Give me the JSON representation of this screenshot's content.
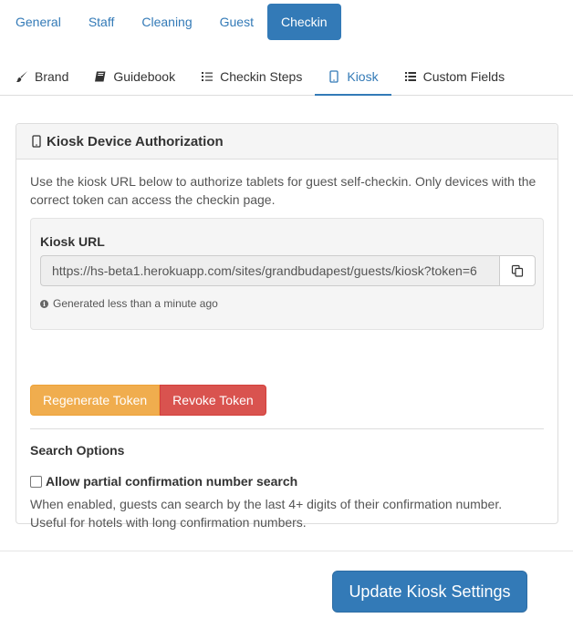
{
  "top_nav": {
    "items": [
      {
        "label": "General"
      },
      {
        "label": "Staff"
      },
      {
        "label": "Cleaning"
      },
      {
        "label": "Guest"
      },
      {
        "label": "Checkin"
      }
    ],
    "active_index": 4
  },
  "sub_tabs": {
    "items": [
      {
        "label": "Brand",
        "icon": "paintbrush-icon"
      },
      {
        "label": "Guidebook",
        "icon": "book-icon"
      },
      {
        "label": "Checkin Steps",
        "icon": "list-icon"
      },
      {
        "label": "Kiosk",
        "icon": "tablet-icon"
      },
      {
        "label": "Custom Fields",
        "icon": "list-icon"
      }
    ],
    "active_index": 3
  },
  "panel": {
    "title": "Kiosk Device Authorization",
    "title_icon": "tablet-icon",
    "description": "Use the kiosk URL below to authorize tablets for guest self-checkin. Only devices with the correct token can access the checkin page.",
    "kiosk_url": {
      "label": "Kiosk URL",
      "value": "https://hs-beta1.herokuapp.com/sites/grandbudapest/guests/kiosk?token=6",
      "copy_icon": "copy-icon",
      "help_icon": "info-icon",
      "generated_text": "Generated less than a minute ago"
    },
    "buttons": {
      "regenerate": "Regenerate Token",
      "revoke": "Revoke Token"
    },
    "search_options": {
      "title": "Search Options",
      "checkbox_label": "Allow partial confirmation number search",
      "checked": false,
      "help": "When enabled, guests can search by the last 4+ digits of their confirmation number. Useful for hotels with long confirmation numbers."
    }
  },
  "footer": {
    "submit_label": "Update Kiosk Settings"
  },
  "colors": {
    "primary": "#337ab7",
    "warning": "#f0ad4e",
    "danger": "#d9534f"
  }
}
